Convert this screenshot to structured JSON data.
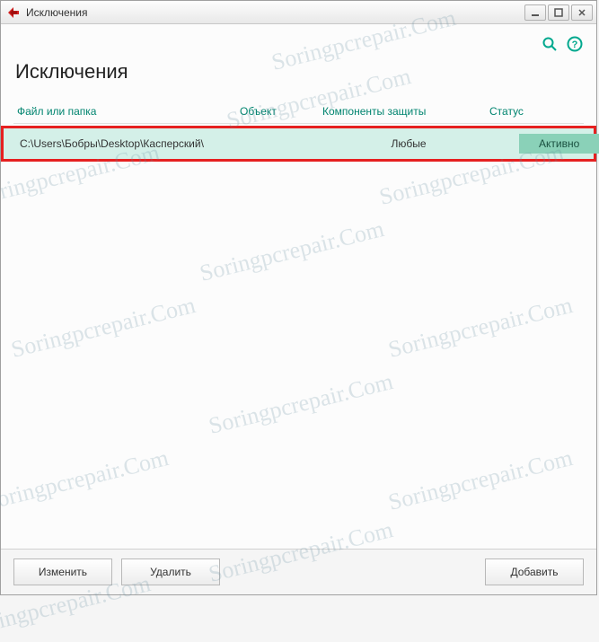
{
  "window": {
    "title": "Исключения"
  },
  "page": {
    "title": "Исключения"
  },
  "columns": {
    "file": "Файл или папка",
    "object": "Объект",
    "components": "Компоненты защиты",
    "status": "Статус"
  },
  "rows": [
    {
      "file": "C:\\Users\\Бобры\\Desktop\\Касперский\\",
      "object": "",
      "components": "Любые",
      "status": "Активно"
    }
  ],
  "buttons": {
    "edit": "Изменить",
    "delete": "Удалить",
    "add": "Добавить"
  },
  "watermark": "Soringpcrepair.Com"
}
